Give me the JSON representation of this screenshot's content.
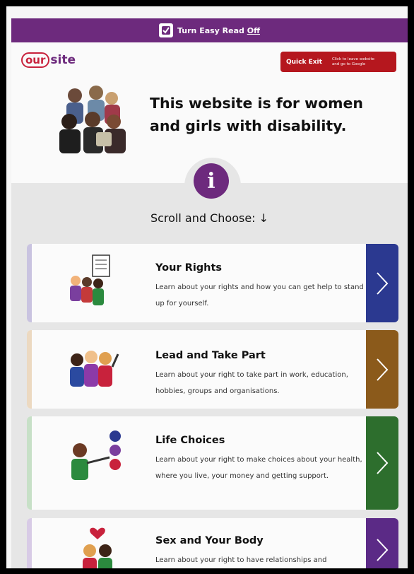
{
  "easy_read": {
    "label": "Turn Easy Read ",
    "state": "Off"
  },
  "logo": {
    "part1": "our",
    "part2": "site"
  },
  "quick_exit": {
    "label": "Quick Exit",
    "note": "Click to leave website and go to Google"
  },
  "hero": {
    "title": "This website is for women and girls with disability."
  },
  "scroll": {
    "label": "Scroll and Choose:",
    "arrow": "↓"
  },
  "cards": [
    {
      "title": "Your Rights",
      "desc": "Learn about your rights and how you can get help to stand up for yourself.",
      "color": "#2b3990",
      "strip": "#c9c3e0"
    },
    {
      "title": "Lead and Take Part",
      "desc": "Learn about your right to take part in work, education, hobbies, groups and organisations.",
      "color": "#8b5a1b",
      "strip": "#ecd9c1"
    },
    {
      "title": "Life Choices",
      "desc": "Learn about your right to make choices about your health, where you live, your money and getting support.",
      "color": "#2d6e2d",
      "strip": "#c7e0c7"
    },
    {
      "title": "Sex and Your Body",
      "desc": "Learn about your right to have relationships and",
      "color": "#5b2a86",
      "strip": "#d8cbe6"
    }
  ]
}
